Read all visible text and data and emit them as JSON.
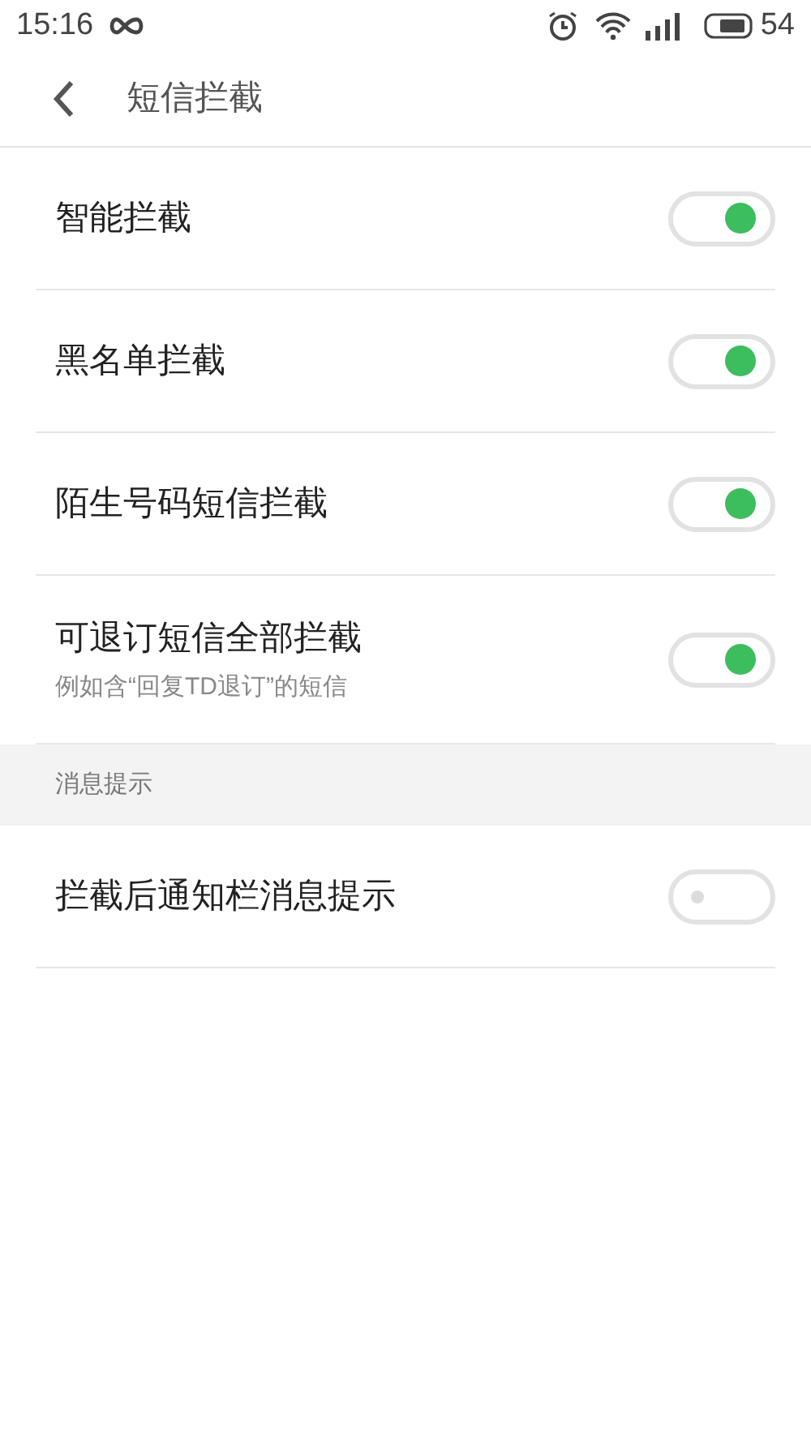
{
  "status_bar": {
    "time": "15:16",
    "battery": "54"
  },
  "header": {
    "title": "短信拦截"
  },
  "sections": [
    {
      "items": [
        {
          "label": "智能拦截",
          "on": true
        },
        {
          "label": "黑名单拦截",
          "on": true
        },
        {
          "label": "陌生号码短信拦截",
          "on": true
        },
        {
          "label": "可退订短信全部拦截",
          "subtitle": "例如含“回复TD退订”的短信",
          "on": true
        }
      ]
    },
    {
      "title": "消息提示",
      "items": [
        {
          "label": "拦截后通知栏消息提示",
          "on": false
        }
      ]
    }
  ]
}
